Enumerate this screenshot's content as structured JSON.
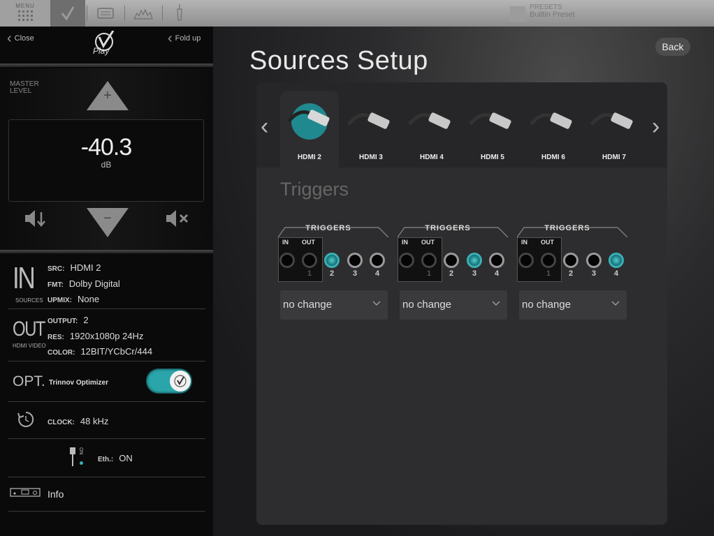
{
  "topbar": {
    "menu_label": "MENU",
    "presets_label": "PRESETS",
    "preset_name": "Builtin Preset"
  },
  "sidebar": {
    "close_label": "Close",
    "foldup_label": "Fold up",
    "play_label": "Play",
    "master_level_label": "MASTER LEVEL",
    "volume_value": "-40.3",
    "volume_unit": "dB",
    "in": {
      "big": "IN",
      "caption": "SOURCES",
      "src_key": "SRC:",
      "src_val": "HDMI 2",
      "fmt_key": "FMT:",
      "fmt_val": "Dolby Digital",
      "upmix_key": "UPMIX:",
      "upmix_val": "None"
    },
    "out": {
      "big": "OUT",
      "caption": "HDMI VIDEO",
      "output_key": "OUTPUT:",
      "output_val": "2",
      "res_key": "RES:",
      "res_val": "1920x1080p 24Hz",
      "color_key": "COLOR:",
      "color_val": "12BIT/YCbCr/444"
    },
    "opt": {
      "big": "OPT.",
      "label": "Trinnov Optimizer",
      "enabled": true
    },
    "clock": {
      "key": "CLOCK:",
      "val": "48 kHz"
    },
    "eth": {
      "key": "Eth.:",
      "val": "ON",
      "on_glyph": "ON"
    },
    "info_label": "Info"
  },
  "main": {
    "title": "Sources Setup",
    "back_label": "Back",
    "sources": [
      {
        "label": "HDMI 2",
        "active": true
      },
      {
        "label": "HDMI 3",
        "active": false
      },
      {
        "label": "HDMI 4",
        "active": false
      },
      {
        "label": "HDMI 5",
        "active": false
      },
      {
        "label": "HDMI 6",
        "active": false
      },
      {
        "label": "HDMI 7",
        "active": false
      }
    ],
    "triggers_title": "Triggers",
    "trigger_groups": [
      {
        "header": "TRIGGERS",
        "in_label": "IN",
        "out_label": "OUT",
        "jack_numbers": [
          "1",
          "2",
          "3",
          "4"
        ],
        "active_jack": "2",
        "dropdown_value": "no change"
      },
      {
        "header": "TRIGGERS",
        "in_label": "IN",
        "out_label": "OUT",
        "jack_numbers": [
          "1",
          "2",
          "3",
          "4"
        ],
        "active_jack": "3",
        "dropdown_value": "no change"
      },
      {
        "header": "TRIGGERS",
        "in_label": "IN",
        "out_label": "OUT",
        "jack_numbers": [
          "1",
          "2",
          "3",
          "4"
        ],
        "active_jack": "4",
        "dropdown_value": "no change"
      }
    ]
  },
  "colors": {
    "accent": "#2aa5aa",
    "sidebar_bg": "#0a0a0a",
    "panel_bg": "#2d2d2f"
  }
}
